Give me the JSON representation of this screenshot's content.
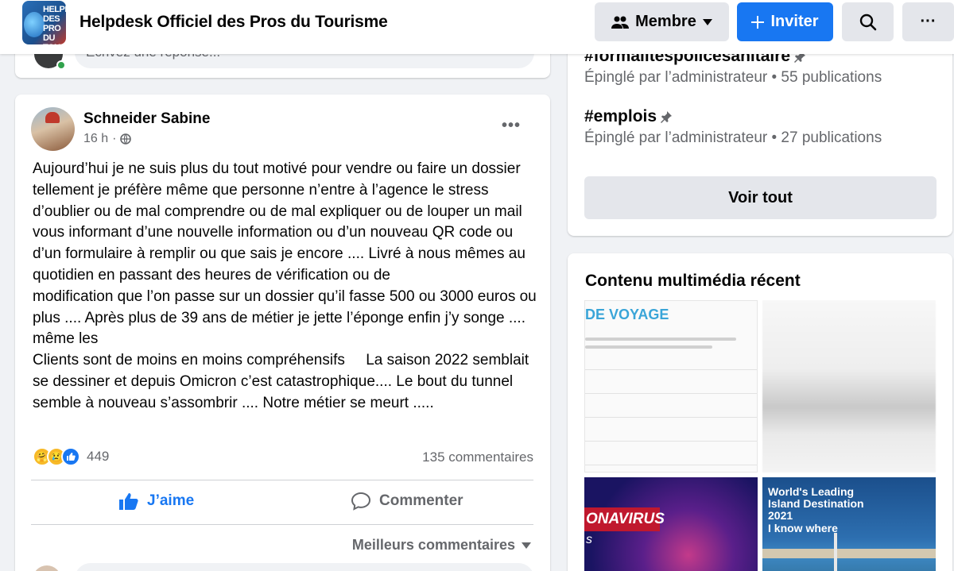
{
  "header": {
    "group_title": "Helpdesk Officiel des Pros du Tourisme",
    "thumb_text": "HELPD DES PRO DU TOUR",
    "membre_label": "Membre",
    "inviter_label": "Inviter",
    "more_label": "···"
  },
  "prev_post": {
    "comment_placeholder": "Écrivez une réponse..."
  },
  "post": {
    "author": "Schneider Sabine",
    "time": "16 h",
    "time_sep": "·",
    "body": [
      "Aujourd’hui je ne suis plus du tout motivé pour vendre ou faire un dossier tellement je préfère même que personne n’entre à l’agence le stress d’oublier ou de mal comprendre ou de mal expliquer ou de louper un mail vous informant d’une nouvelle information ou d’un nouveau QR code ou d’un formulaire à remplir ou que sais je encore .... Livré à nous mêmes au quotidien en passant des heures de vérification ou de",
      "modification que l’on passe sur un dossier qu’il fasse 500 ou 3000 euros ou plus .... Après plus de 39 ans de métier je jette l’éponge enfin j’y songe .... même les",
      "Clients sont de moins en moins compréhensifs     La saison 2022 semblait se dessiner et depuis Omicron c’est catastrophique.... Le bout du tunnel semble à nouveau s’assombrir .... Notre métier se meurt ....."
    ],
    "reaction_count": "449",
    "comment_count": "135 commentaires",
    "like_label": "J’aime",
    "comment_label": "Commenter",
    "best_comments_label": "Meilleurs commentaires"
  },
  "pinned_topics": [
    {
      "name": "#formalitespolicesanitaire",
      "meta": "Épinglé par l’administrateur • 55 publications"
    },
    {
      "name": "#emplois",
      "meta": "Épinglé par l’administrateur • 27 publications"
    }
  ],
  "voir_tout_label": "Voir tout",
  "media": {
    "title": "Contenu multimédia récent",
    "tile1_text": "DE VOYAGE",
    "tile3_text": "ONAVIRUS",
    "tile4_text": "World's Leading Island Destination 2021",
    "tile4_text2": "I know where"
  },
  "colors": {
    "brand_blue": "#1877f2",
    "secondary_text": "#65676b",
    "button_gray": "#e4e6eb",
    "page_bg": "#f0f2f5"
  }
}
